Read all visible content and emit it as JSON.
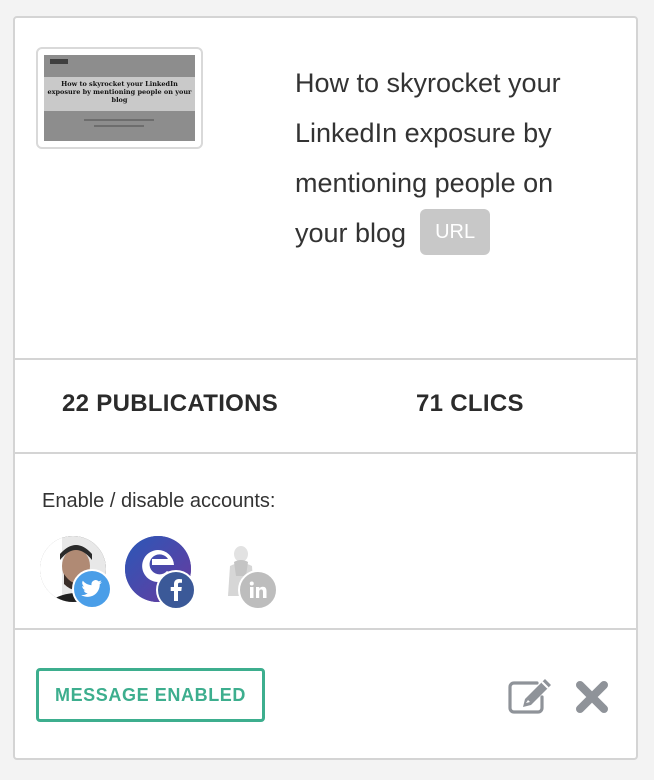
{
  "post": {
    "title": "How to skyrocket your LinkedIn exposure by mentioning people on your blog",
    "url_label": "URL",
    "thumbnail_title": "How to skyrocket your LinkedIn exposure by mentioning people on your blog"
  },
  "stats": {
    "publications": "22 PUBLICATIONS",
    "clicks": "71 CLICS"
  },
  "accounts": {
    "label": "Enable / disable accounts:",
    "items": [
      {
        "network": "twitter",
        "badge_icon": "twitter-icon",
        "badge_color": "#4a9ee8",
        "enabled": true
      },
      {
        "network": "facebook",
        "badge_icon": "facebook-icon",
        "badge_color": "#3b5998",
        "enabled": true
      },
      {
        "network": "linkedin",
        "badge_icon": "linkedin-icon",
        "badge_color": "#bdbdbd",
        "enabled": false
      }
    ]
  },
  "footer": {
    "message_button": "MESSAGE ENABLED",
    "accent_color": "#3dae8e",
    "edit_icon": "edit-icon",
    "delete_icon": "close-icon"
  }
}
